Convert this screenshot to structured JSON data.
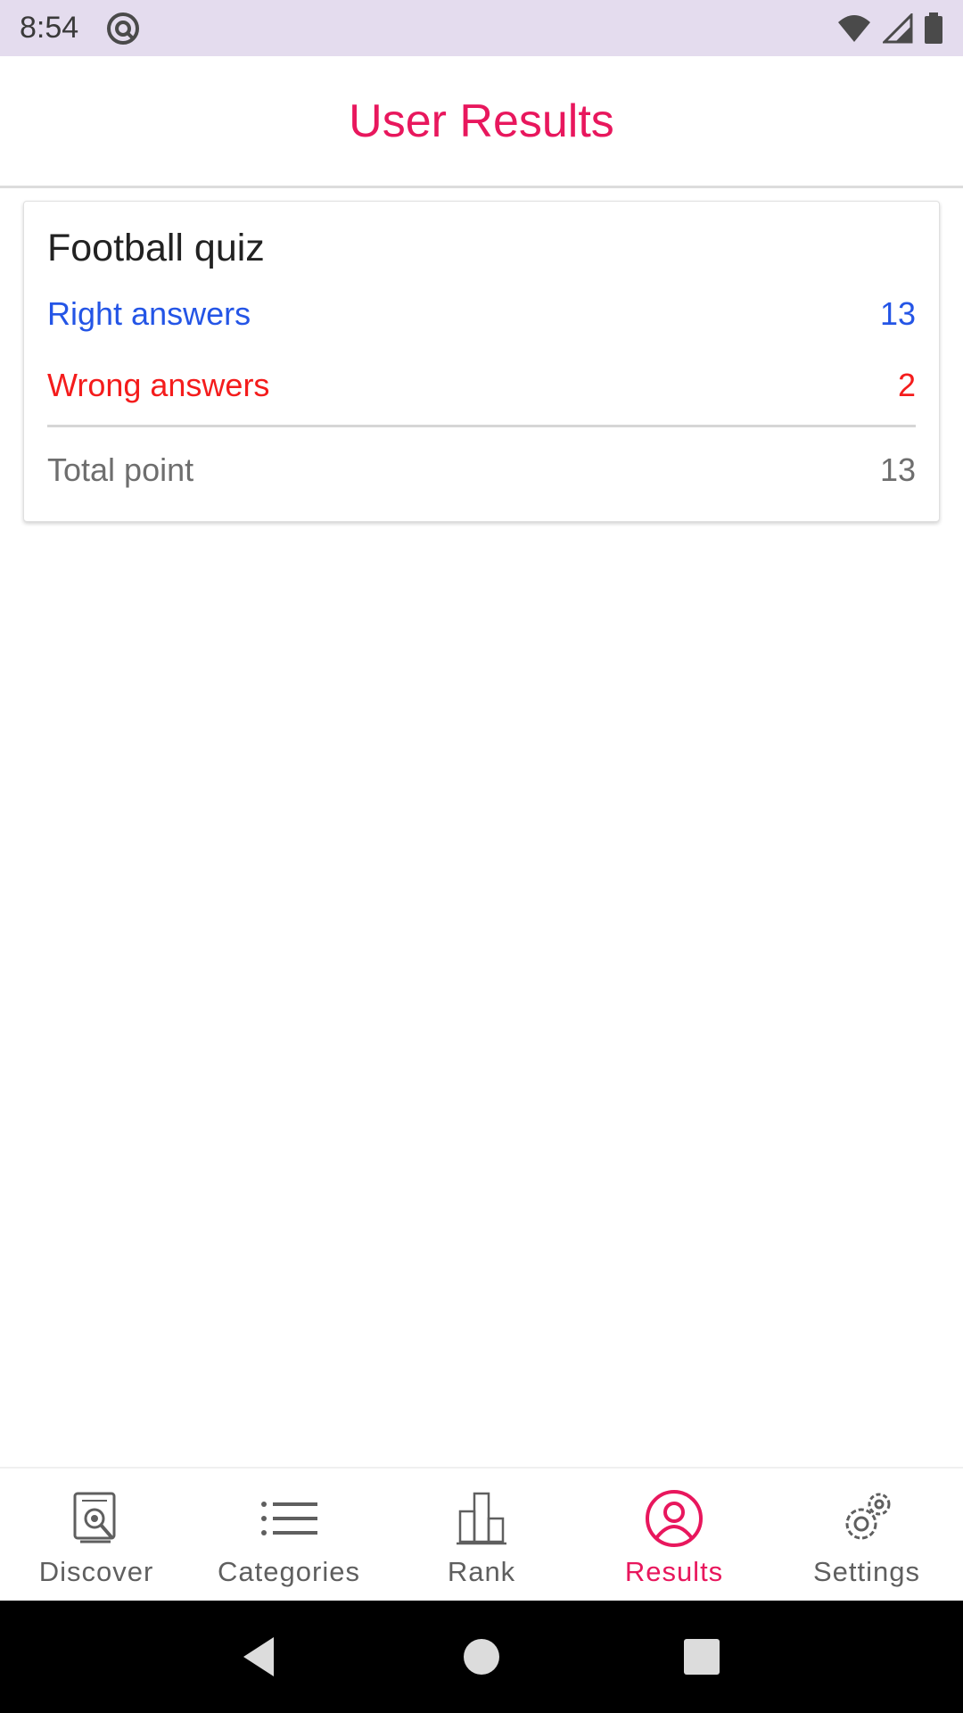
{
  "status_bar": {
    "time": "8:54"
  },
  "header": {
    "title": "User Results"
  },
  "result_card": {
    "quiz_name": "Football quiz",
    "right_label": "Right answers",
    "right_value": "13",
    "wrong_label": "Wrong answers",
    "wrong_value": "2",
    "total_label": "Total point",
    "total_value": "13"
  },
  "bottom_nav": {
    "items": [
      {
        "label": "Discover",
        "icon": "discover-icon"
      },
      {
        "label": "Categories",
        "icon": "list-icon"
      },
      {
        "label": "Rank",
        "icon": "podium-icon"
      },
      {
        "label": "Results",
        "icon": "user-icon",
        "active": true
      },
      {
        "label": "Settings",
        "icon": "gear-icon"
      }
    ]
  },
  "colors": {
    "accent": "#e8175d",
    "right": "#2455e6",
    "wrong": "#f41c1c",
    "status_bar_bg": "#e4dcee"
  }
}
